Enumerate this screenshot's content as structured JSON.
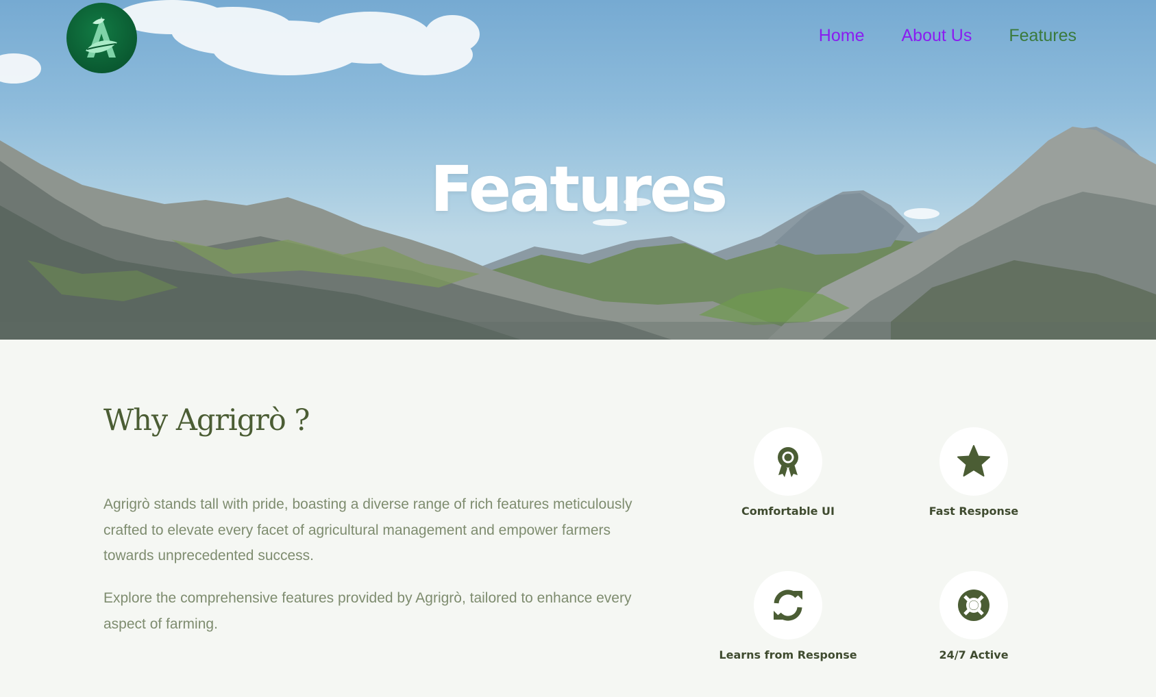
{
  "brand": {
    "logo_icon": "leaf-letter-a-logo"
  },
  "nav": {
    "items": [
      {
        "label": "Home",
        "state": "visited"
      },
      {
        "label": "About Us",
        "state": "visited"
      },
      {
        "label": "Features",
        "state": "current"
      }
    ]
  },
  "hero": {
    "title": "Features"
  },
  "why": {
    "title": "Why Agrigrò ?",
    "paragraphs": [
      "Agrigrò stands tall with pride, boasting a diverse range of rich features meticulously crafted to elevate every facet of agricultural management and empower farmers towards unprecedented success.",
      "Explore the comprehensive features provided by Agrigrò, tailored to enhance every aspect of farming."
    ]
  },
  "features": [
    {
      "label": "Comfortable UI",
      "icon": "award-ribbon-icon"
    },
    {
      "label": "Fast Response",
      "icon": "star-icon"
    },
    {
      "label": "Learns from Response",
      "icon": "sync-arrows-icon"
    },
    {
      "label": "24/7 Active",
      "icon": "lifebuoy-icon"
    }
  ],
  "colors": {
    "nav_visited": "#8a1df0",
    "nav_current": "#3a7a3c",
    "accent_green": "#4b5d34",
    "body_text": "#7e8c6f",
    "background": "#f5f7f3",
    "logo_green": "#0a5a31"
  }
}
